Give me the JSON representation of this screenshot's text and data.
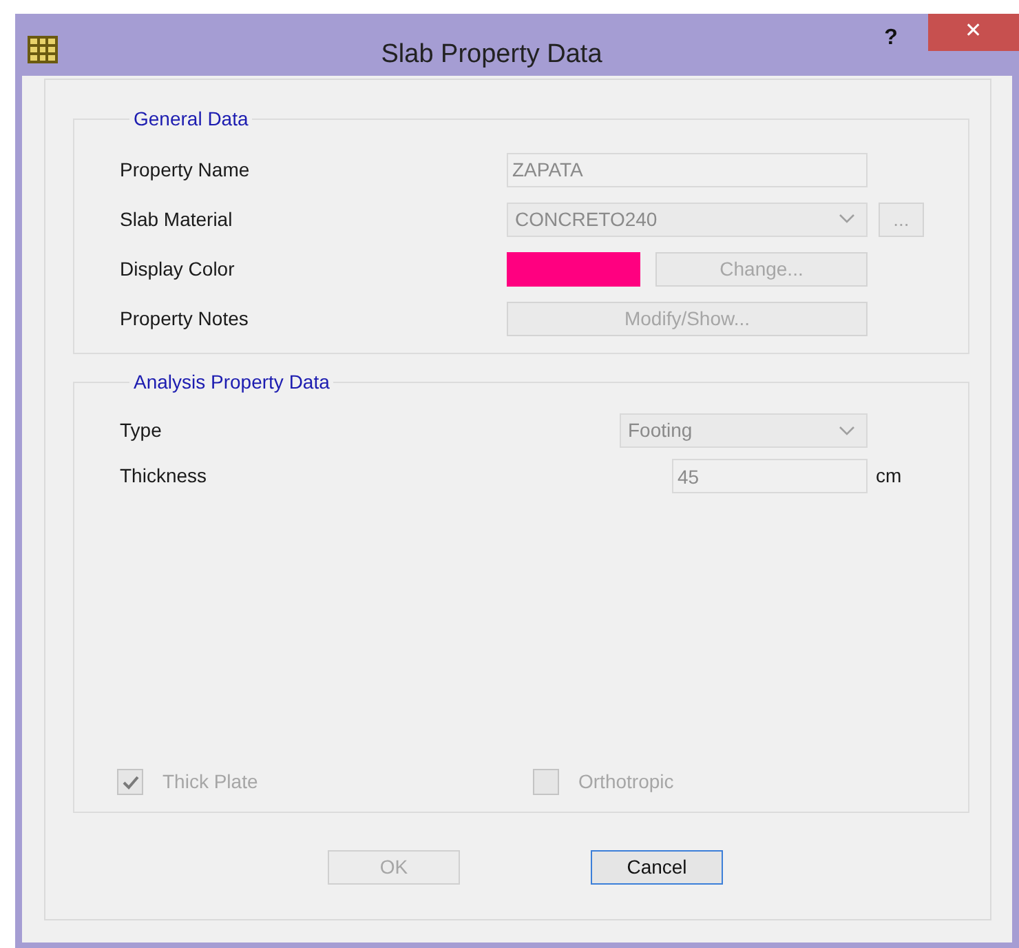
{
  "window": {
    "title": "Slab Property Data",
    "help": "?",
    "close": "✕"
  },
  "general_data": {
    "title": "General Data",
    "fields": [
      {
        "kind": "text",
        "label": "Property Name",
        "value": "ZAPATA"
      },
      {
        "kind": "dropdown",
        "label": "Slab Material",
        "value": "CONCRETO240",
        "extra_button": "..."
      },
      {
        "kind": "color",
        "label": "Display Color",
        "color": "#ff0080",
        "button": "Change..."
      },
      {
        "kind": "button",
        "label": "Property Notes",
        "button": "Modify/Show..."
      }
    ]
  },
  "analysis_data": {
    "title": "Analysis Property Data",
    "fields": [
      {
        "kind": "dropdown",
        "label": "Type",
        "value": "Footing"
      },
      {
        "kind": "text",
        "label": "Thickness",
        "value": "45",
        "unit": "cm"
      }
    ],
    "options": [
      {
        "label": "Thick Plate",
        "checked": true,
        "disabled": true
      },
      {
        "label": "Orthotropic",
        "checked": false,
        "disabled": true
      }
    ]
  },
  "buttons": [
    {
      "label": "OK",
      "disabled": true
    },
    {
      "label": "Cancel",
      "disabled": false
    }
  ]
}
